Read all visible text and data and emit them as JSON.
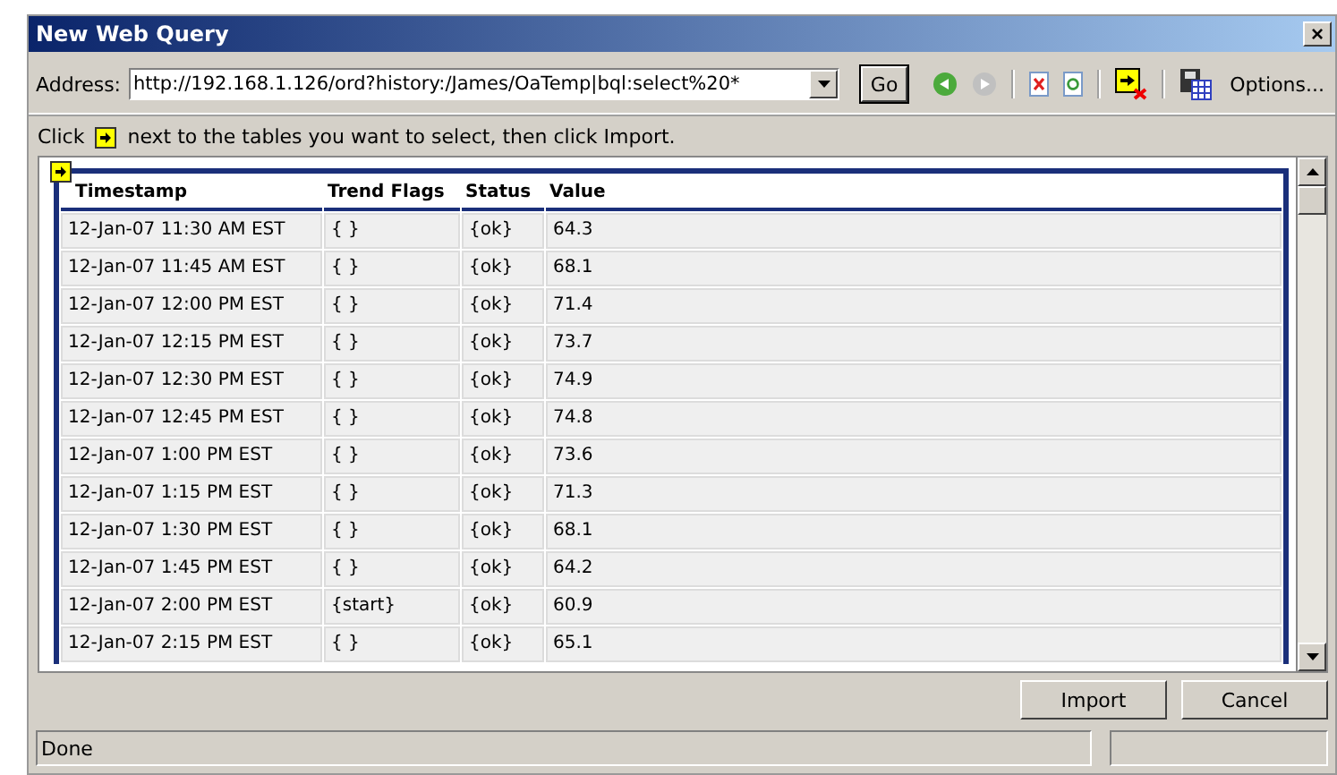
{
  "window": {
    "title": "New Web Query",
    "close": "×"
  },
  "address": {
    "label": "Address:",
    "value": "http://192.168.1.126/ord?history:/James/OaTemp|bql:select%20*",
    "go": "Go",
    "options": "Options..."
  },
  "instruction": {
    "before": "Click",
    "after": "next to the tables you want to select, then click Import."
  },
  "table": {
    "columns": [
      "Timestamp",
      "Trend Flags",
      "Status",
      "Value"
    ],
    "rows": [
      [
        "12-Jan-07 11:30 AM EST",
        "{ }",
        "{ok}",
        "64.3"
      ],
      [
        "12-Jan-07 11:45 AM EST",
        "{ }",
        "{ok}",
        "68.1"
      ],
      [
        "12-Jan-07 12:00 PM EST",
        "{ }",
        "{ok}",
        "71.4"
      ],
      [
        "12-Jan-07 12:15 PM EST",
        "{ }",
        "{ok}",
        "73.7"
      ],
      [
        "12-Jan-07 12:30 PM EST",
        "{ }",
        "{ok}",
        "74.9"
      ],
      [
        "12-Jan-07 12:45 PM EST",
        "{ }",
        "{ok}",
        "74.8"
      ],
      [
        "12-Jan-07 1:00 PM EST",
        "{ }",
        "{ok}",
        "73.6"
      ],
      [
        "12-Jan-07 1:15 PM EST",
        "{ }",
        "{ok}",
        "71.3"
      ],
      [
        "12-Jan-07 1:30 PM EST",
        "{ }",
        "{ok}",
        "68.1"
      ],
      [
        "12-Jan-07 1:45 PM EST",
        "{ }",
        "{ok}",
        "64.2"
      ],
      [
        "12-Jan-07 2:00 PM EST",
        "{start}",
        "{ok}",
        "60.9"
      ],
      [
        "12-Jan-07 2:15 PM EST",
        "{ }",
        "{ok}",
        "65.1"
      ]
    ]
  },
  "buttons": [
    "Import",
    "Cancel"
  ],
  "status_bar": {
    "text": "Done"
  }
}
